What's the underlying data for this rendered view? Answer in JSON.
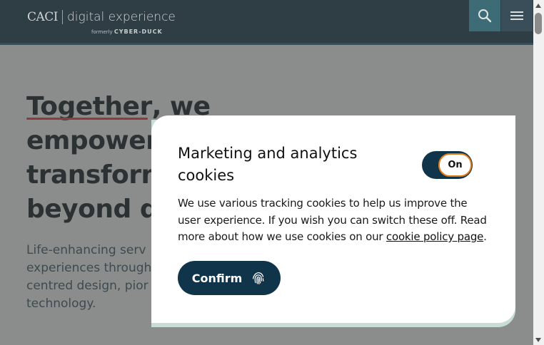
{
  "header": {
    "logo_primary": "CACI",
    "logo_secondary": "digital experience",
    "logo_formerly": "formerly",
    "logo_formerly_brand": "CYBER-DUCK",
    "search_icon": "search-icon",
    "menu_icon": "hamburger-menu-icon"
  },
  "hero": {
    "title_word_1": "Together",
    "title_rest": ", we empower transform beyond dy",
    "title_lines": [
      "empower",
      "transform",
      "beyond dy"
    ],
    "subtitle": "Life-enhancing serv experiences through centred design, pior and technology."
  },
  "cookie_dialog": {
    "title": "Marketing and analytics cookies",
    "toggle_label": "On",
    "toggle_state": "on",
    "body_text": "We use various tracking cookies to help us improve the user experience. If you wish you can switch these off. Read more about how we use cookies on our ",
    "link_text": "cookie policy page",
    "body_end": ".",
    "confirm_label": "Confirm",
    "confirm_icon": "fingerprint-icon"
  },
  "colors": {
    "header_bg": "#2f3d45",
    "accent_teal": "#3d6b76",
    "button_navy": "#10354a",
    "toggle_outline": "#e07b1a",
    "underline_red": "#8f3a3c"
  }
}
